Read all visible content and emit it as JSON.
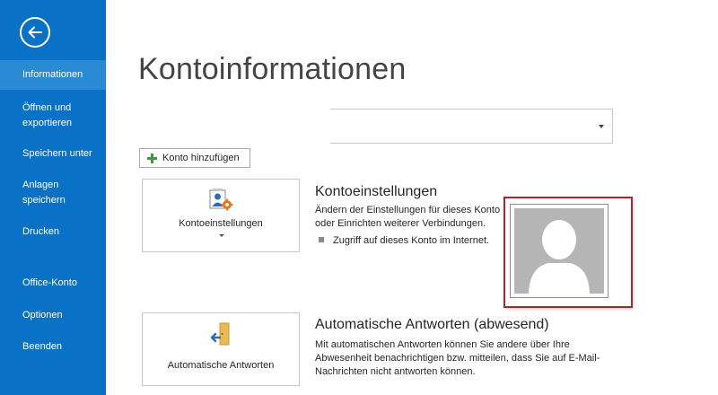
{
  "sidebar": {
    "items": [
      {
        "label": "Informationen",
        "active": true
      },
      {
        "label": "Öffnen und exportieren"
      },
      {
        "label": "Speichern unter"
      },
      {
        "label": "Anlagen speichern"
      },
      {
        "label": "Drucken"
      },
      {
        "label": "Office-Konto"
      },
      {
        "label": "Optionen"
      },
      {
        "label": "Beenden"
      }
    ]
  },
  "main": {
    "title": "Kontoinformationen",
    "account_select": {
      "value": ""
    },
    "add_account_label": "Konto hinzufügen",
    "account_settings": {
      "button_label": "Kontoeinstellungen",
      "title": "Kontoeinstellungen",
      "desc_line1": "Ändern der Einstellungen für dieses Konto",
      "desc_line2": "oder Einrichten weiterer Verbindungen.",
      "bullet": "Zugriff auf dieses Konto im Internet."
    },
    "auto_reply": {
      "button_label": "Automatische Antworten",
      "title": "Automatische Antworten (abwesend)",
      "desc_line1": "Mit automatischen Antworten können Sie andere über Ihre",
      "desc_line2": "Abwesenheit benachrichtigen bzw. mitteilen, dass Sie auf E-Mail-",
      "desc_line3": "Nachrichten nicht antworten können."
    }
  },
  "colors": {
    "sidebar_bg": "#0a72c6",
    "sidebar_active": "#2a8ad4",
    "photo_border": "#b0242b",
    "add_plus": "#3a9a45"
  }
}
